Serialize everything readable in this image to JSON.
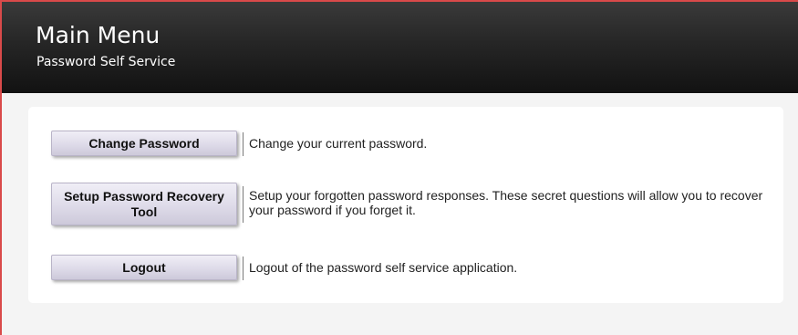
{
  "header": {
    "title": "Main Menu",
    "subtitle": "Password Self Service"
  },
  "menu": {
    "items": [
      {
        "button_label": "Change Password",
        "description": "Change your current password."
      },
      {
        "button_label": "Setup Password Recovery Tool",
        "description": "Setup your forgotten password responses. These secret questions will allow you to recover your password if you forget it."
      },
      {
        "button_label": "Logout",
        "description": "Logout of the password self service application."
      }
    ]
  },
  "colors": {
    "accent_border": "#d94a4a",
    "header_dark": "#121212",
    "button_face": "#dedbe9"
  }
}
